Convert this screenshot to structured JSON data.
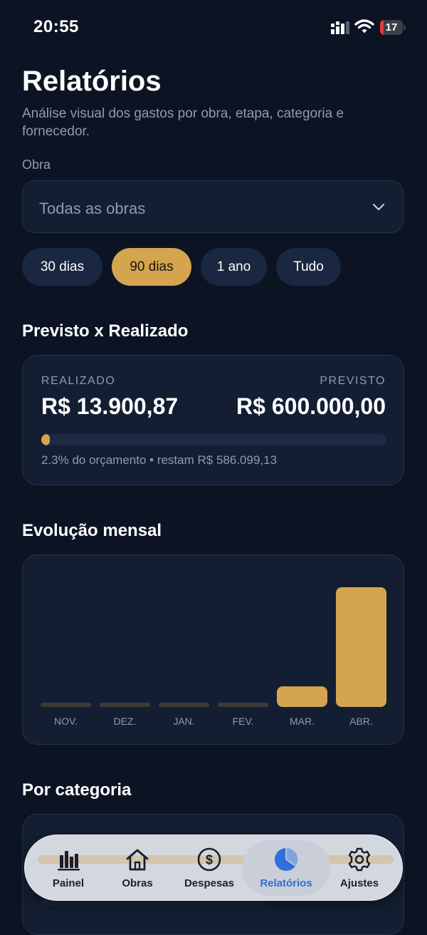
{
  "status_bar": {
    "time": "20:55",
    "battery_level": "17",
    "battery_fraction": 0.17,
    "battery_color": "#e23a3a"
  },
  "header": {
    "title": "Relatórios",
    "subtitle": "Análise visual dos gastos por obra, etapa, categoria e fornecedor."
  },
  "filters": {
    "obra_label": "Obra",
    "obra_value": "Todas as obras",
    "periods": [
      {
        "label": "30 dias",
        "active": false
      },
      {
        "label": "90 dias",
        "active": true
      },
      {
        "label": "1 ano",
        "active": false
      },
      {
        "label": "Tudo",
        "active": false
      }
    ]
  },
  "budget": {
    "section_title": "Previsto x Realizado",
    "realizado_label": "REALIZADO",
    "realizado_value": "R$ 13.900,87",
    "previsto_label": "PREVISTO",
    "previsto_value": "R$ 600.000,00",
    "progress_percent": 2.3,
    "note": "2.3% do orçamento • restam R$ 586.099,13"
  },
  "monthly": {
    "section_title": "Evolução mensal"
  },
  "chart_data": {
    "type": "bar",
    "categories": [
      "NOV.",
      "DEZ.",
      "JAN.",
      "FEV.",
      "MAR.",
      "ABR."
    ],
    "values": [
      0,
      0,
      0,
      0,
      1750,
      10200
    ],
    "bar_color": "#d4a54e",
    "empty_bar_color": "#3d3b35",
    "grid": false,
    "legend": "none"
  },
  "category": {
    "section_title": "Por categoria"
  },
  "tabbar": {
    "accent": "#2f6fdc",
    "items": [
      {
        "label": "Painel",
        "icon": "bar-chart-icon"
      },
      {
        "label": "Obras",
        "icon": "house-icon"
      },
      {
        "label": "Despesas",
        "icon": "dollar-circle-icon"
      },
      {
        "label": "Relatórios",
        "icon": "pie-chart-icon",
        "selected": true
      },
      {
        "label": "Ajustes",
        "icon": "gear-icon"
      }
    ]
  }
}
